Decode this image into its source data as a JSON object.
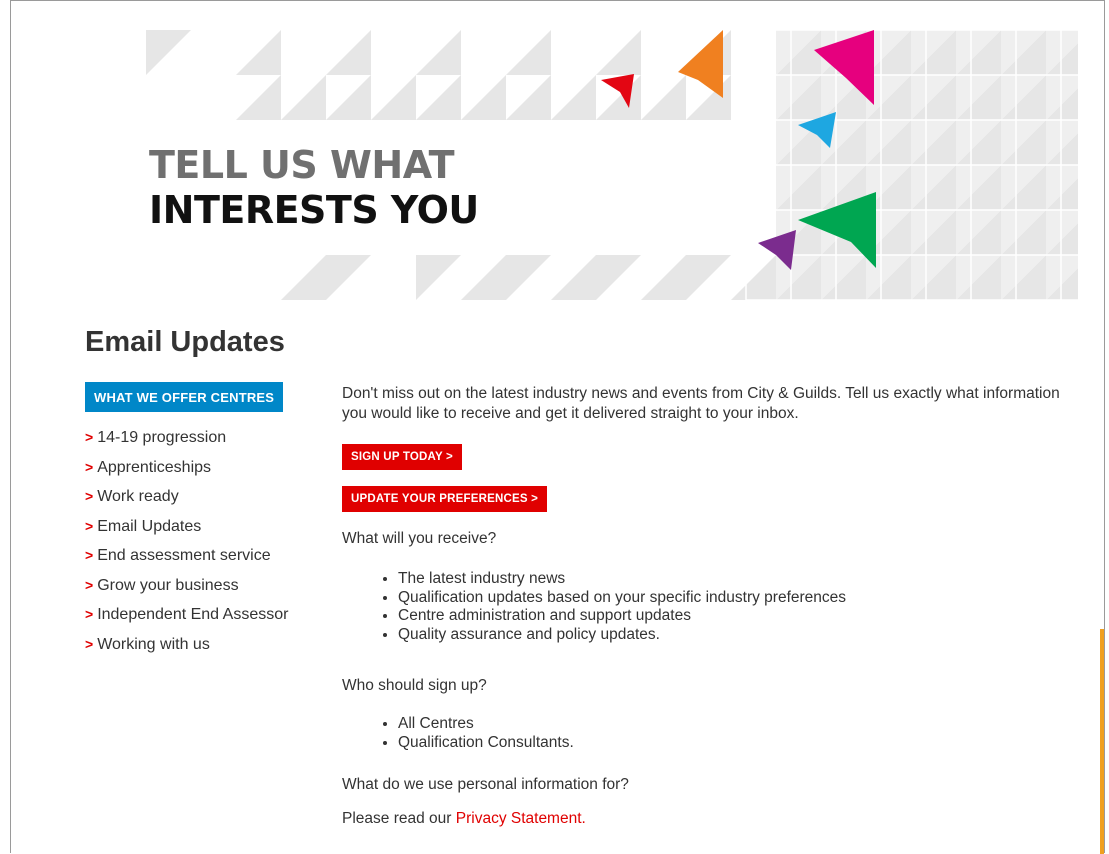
{
  "banner": {
    "line1": "TELL US WHAT",
    "line2": "INTERESTS YOU",
    "colors": {
      "orange": "#f08020",
      "magenta": "#e6007e",
      "cyan": "#1ea7e1",
      "green": "#00a651",
      "purple": "#7b2c8e",
      "red": "#e30613",
      "pattern": "#e6e6e6"
    }
  },
  "page_title": "Email Updates",
  "sidebar": {
    "header": "WHAT WE OFFER CENTRES",
    "arrow": ">",
    "items": [
      "14-19 progression",
      "Apprenticeships",
      "Work ready",
      "Email Updates",
      "End assessment service",
      "Grow your business",
      "Independent End Assessor",
      "Working with us"
    ]
  },
  "main": {
    "intro": "Don't miss out on the latest industry news and events from City & Guilds. Tell us exactly what information you would like to receive and get it delivered straight to your inbox.",
    "signup_button": "SIGN UP TODAY >",
    "update_button": "UPDATE YOUR PREFERENCES >",
    "question_receive": "What will you receive?",
    "receive_items": [
      "The latest industry news",
      "Qualification updates based on your specific industry preferences",
      "Centre administration and support updates",
      "Quality assurance and policy updates."
    ],
    "question_who": "Who should sign up?",
    "who_items": [
      "All Centres",
      "Qualification Consultants."
    ],
    "question_personal": "What do we use personal information for?",
    "privacy_prefix": "Please read our ",
    "privacy_link": "Privacy Statement."
  }
}
